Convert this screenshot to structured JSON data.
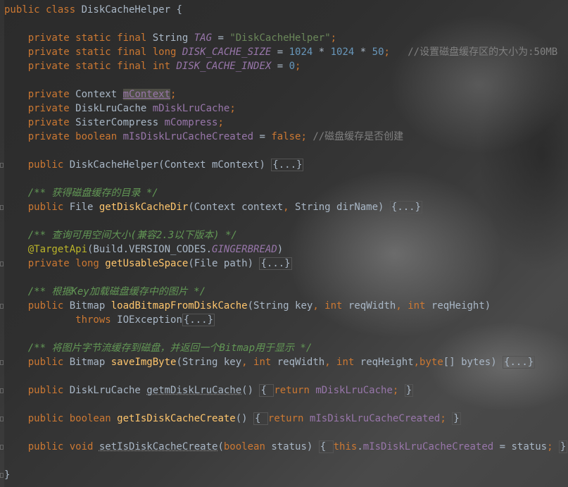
{
  "editor": {
    "language": "Java",
    "lines": [
      [
        [
          "k",
          "public class "
        ],
        [
          "p",
          "DiskCacheHelper {"
        ]
      ],
      [],
      [
        [
          "k",
          "    private static final "
        ],
        [
          "p",
          "String "
        ],
        [
          "c",
          "TAG"
        ],
        [
          "p",
          " = "
        ],
        [
          "s",
          "\"DiskCacheHelper\""
        ],
        [
          "k",
          ";"
        ]
      ],
      [
        [
          "k",
          "    private static final long "
        ],
        [
          "c",
          "DISK_CACHE_SIZE"
        ],
        [
          "p",
          " = "
        ],
        [
          "n",
          "1024"
        ],
        [
          "p",
          " * "
        ],
        [
          "n",
          "1024"
        ],
        [
          "p",
          " * "
        ],
        [
          "n",
          "50"
        ],
        [
          "k",
          ";"
        ],
        [
          "cm",
          "   //设置磁盘缓存区的大小为:50MB"
        ]
      ],
      [
        [
          "k",
          "    private static final int "
        ],
        [
          "c",
          "DISK_CACHE_INDEX"
        ],
        [
          "p",
          " = "
        ],
        [
          "n",
          "0"
        ],
        [
          "k",
          ";"
        ]
      ],
      [],
      [
        [
          "k",
          "    private "
        ],
        [
          "p",
          "Context "
        ],
        [
          "hl",
          "mContext"
        ],
        [
          "k",
          ";"
        ]
      ],
      [
        [
          "k",
          "    private "
        ],
        [
          "p",
          "DiskLruCache "
        ],
        [
          "f",
          "mDiskLruCache"
        ],
        [
          "k",
          ";"
        ]
      ],
      [
        [
          "k",
          "    private "
        ],
        [
          "p",
          "SisterCompress "
        ],
        [
          "f",
          "mCompress"
        ],
        [
          "k",
          ";"
        ]
      ],
      [
        [
          "k",
          "    private boolean "
        ],
        [
          "f",
          "mIsDiskLruCacheCreated"
        ],
        [
          "p",
          " = "
        ],
        [
          "k",
          "false"
        ],
        [
          "k",
          "; "
        ],
        [
          "cm",
          "//磁盘缓存是否创建"
        ]
      ],
      [],
      [
        [
          "k",
          "    public "
        ],
        [
          "p",
          "DiskCacheHelper(Context mContext) "
        ],
        [
          "fo",
          "{...}"
        ]
      ],
      [],
      [
        [
          "dc",
          "    /** 获得磁盘缓存的目录 */"
        ]
      ],
      [
        [
          "k",
          "    public "
        ],
        [
          "p",
          "File "
        ],
        [
          "m",
          "getDiskCacheDir"
        ],
        [
          "p",
          "(Context context"
        ],
        [
          "k",
          ", "
        ],
        [
          "p",
          "String dirName) "
        ],
        [
          "fo",
          "{...}"
        ]
      ],
      [],
      [
        [
          "dc",
          "    /** 查询可用空间大小(兼容2.3以下版本) */"
        ]
      ],
      [
        [
          "a",
          "    @TargetApi"
        ],
        [
          "p",
          "(Build.VERSION_CODES."
        ],
        [
          "c",
          "GINGERBREAD"
        ],
        [
          "p",
          ")"
        ]
      ],
      [
        [
          "k",
          "    private long "
        ],
        [
          "m",
          "getUsableSpace"
        ],
        [
          "p",
          "(File path) "
        ],
        [
          "fo",
          "{...}"
        ]
      ],
      [],
      [
        [
          "dc",
          "    /** 根据Key加载磁盘缓存中的图片 */"
        ]
      ],
      [
        [
          "k",
          "    public "
        ],
        [
          "p",
          "Bitmap "
        ],
        [
          "m",
          "loadBitmapFromDiskCache"
        ],
        [
          "p",
          "(String key"
        ],
        [
          "k",
          ", int "
        ],
        [
          "p",
          "reqWidth"
        ],
        [
          "k",
          ", int "
        ],
        [
          "p",
          "reqHeight)"
        ]
      ],
      [
        [
          "k",
          "            throws "
        ],
        [
          "p",
          "IOException"
        ],
        [
          "fo",
          "{...}"
        ]
      ],
      [],
      [
        [
          "dc",
          "    /** 将图片字节流缓存到磁盘，并返回一个Bitmap用于显示 */"
        ]
      ],
      [
        [
          "k",
          "    public "
        ],
        [
          "p",
          "Bitmap "
        ],
        [
          "m",
          "saveImgByte"
        ],
        [
          "p",
          "(String key"
        ],
        [
          "k",
          ", int "
        ],
        [
          "p",
          "reqWidth"
        ],
        [
          "k",
          ", int "
        ],
        [
          "p",
          "reqHeight"
        ],
        [
          "k",
          ",byte"
        ],
        [
          "p",
          "[] bytes) "
        ],
        [
          "fo",
          "{...}"
        ]
      ],
      [],
      [
        [
          "k",
          "    public "
        ],
        [
          "p",
          "DiskLruCache "
        ],
        [
          "ul",
          "getmDiskLruCache"
        ],
        [
          "p",
          "() "
        ],
        [
          "fo",
          "{ "
        ],
        [
          "k",
          "return "
        ],
        [
          "f",
          "mDiskLruCache"
        ],
        [
          "k",
          "; "
        ],
        [
          "fo",
          "}"
        ]
      ],
      [],
      [
        [
          "k",
          "    public boolean "
        ],
        [
          "m",
          "getIsDiskCacheCreate"
        ],
        [
          "p",
          "() "
        ],
        [
          "fo",
          "{ "
        ],
        [
          "k",
          "return "
        ],
        [
          "f",
          "mIsDiskLruCacheCreated"
        ],
        [
          "k",
          "; "
        ],
        [
          "fo",
          "}"
        ]
      ],
      [],
      [
        [
          "k",
          "    public void "
        ],
        [
          "ul",
          "setIsDiskCacheCreate"
        ],
        [
          "p",
          "("
        ],
        [
          "k",
          "boolean "
        ],
        [
          "p",
          "status) "
        ],
        [
          "fo",
          "{ "
        ],
        [
          "k",
          "this"
        ],
        [
          "p",
          "."
        ],
        [
          "f",
          "mIsDiskLruCacheCreated"
        ],
        [
          "p",
          " = status"
        ],
        [
          "k",
          "; "
        ],
        [
          "fo",
          "}"
        ]
      ],
      [],
      [
        [
          "p",
          "}"
        ]
      ]
    ],
    "fold_marker_lines": [
      11,
      14,
      18,
      21,
      25,
      27,
      29,
      31,
      33
    ]
  }
}
